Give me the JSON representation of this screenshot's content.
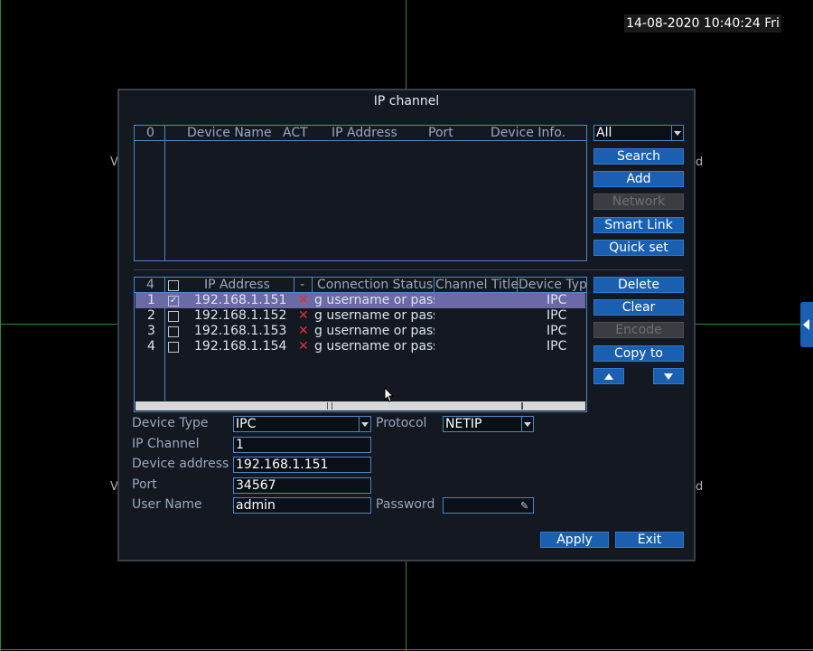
{
  "datetime": "14-08-2020 10:40:24 Fri",
  "edge_chars": {
    "left_top": "V",
    "right_top": "d",
    "left_bottom": "V",
    "right_bottom": "d"
  },
  "dialog": {
    "title": "IP channel",
    "search_table": {
      "headers": [
        "0",
        "Device Name",
        "ACT",
        "IP Address",
        "Port",
        "Device Info."
      ]
    },
    "filter_select": {
      "value": "All"
    },
    "top_buttons": [
      {
        "label": "Search",
        "enabled": true
      },
      {
        "label": "Add",
        "enabled": true
      },
      {
        "label": "Network",
        "enabled": false
      },
      {
        "label": "Smart Link",
        "enabled": true
      },
      {
        "label": "Quick set",
        "enabled": true
      }
    ],
    "channel_table": {
      "headers": [
        "4",
        "",
        "IP Address",
        "-",
        "Connection Status",
        "Channel Title",
        "Device Typ"
      ],
      "rows": [
        {
          "num": "1",
          "checked": true,
          "ip": "192.168.1.151",
          "status": "g username or pass",
          "type": "IPC",
          "selected": true
        },
        {
          "num": "2",
          "checked": false,
          "ip": "192.168.1.152",
          "status": "g username or pass",
          "type": "IPC",
          "selected": false
        },
        {
          "num": "3",
          "checked": false,
          "ip": "192.168.1.153",
          "status": "g username or pass",
          "type": "IPC",
          "selected": false
        },
        {
          "num": "4",
          "checked": false,
          "ip": "192.168.1.154",
          "status": "g username or pass",
          "type": "IPC",
          "selected": false
        }
      ]
    },
    "side_buttons": [
      {
        "label": "Delete",
        "enabled": true
      },
      {
        "label": "Clear",
        "enabled": true
      },
      {
        "label": "Encode",
        "enabled": false
      },
      {
        "label": "Copy to",
        "enabled": true
      }
    ],
    "form": {
      "device_type_label": "Device Type",
      "device_type_value": "IPC",
      "protocol_label": "Protocol",
      "protocol_value": "NETIP",
      "ip_channel_label": "IP Channel",
      "ip_channel_value": "1",
      "device_address_label": "Device address",
      "device_address_value": "192.168.1.151",
      "port_label": "Port",
      "port_value": "34567",
      "user_name_label": "User Name",
      "user_name_value": "admin",
      "password_label": "Password",
      "password_value": ""
    },
    "apply_label": "Apply",
    "exit_label": "Exit"
  },
  "colors": {
    "accent": "#1a5fb0",
    "selected_row": "#6b69a6",
    "grid_line": "#2f8a3a",
    "error_mark": "#e03030"
  }
}
